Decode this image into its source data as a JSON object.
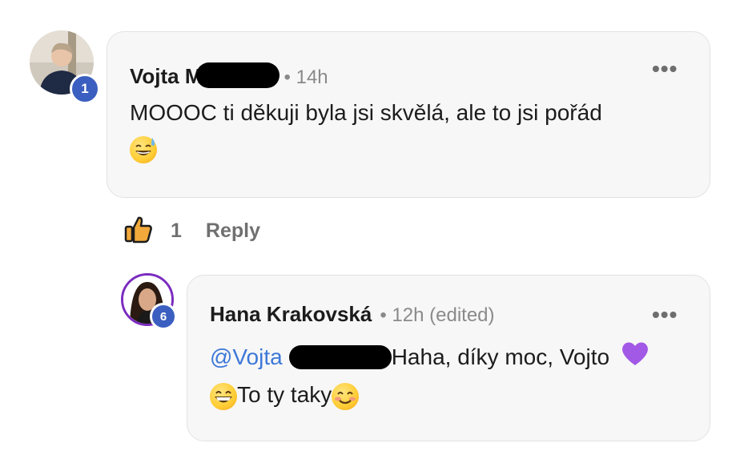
{
  "comment": {
    "author": "Vojta M",
    "time": "• 14h",
    "badge": "1",
    "text_line1": "MOOOC ti děkuji byla jsi skvělá, ale to jsi pořád",
    "emoji": "sweat-smile-emoji",
    "like_count": "1",
    "reply_label": "Reply"
  },
  "reply": {
    "author": "Hana Krakovská",
    "time": "• 12h (edited)",
    "badge": "6",
    "mention": "@Vojta",
    "text_after_mention": "Haha, díky moc, Vojto",
    "heart_emoji": "purple-heart-emoji",
    "text_line2": "To ty taky",
    "emoji_grin": "grinning-emoji",
    "emoji_smile": "smiling-emoji"
  },
  "icons": {
    "more": "more-horizontal-icon",
    "like": "thumbs-up-icon"
  },
  "colors": {
    "badge": "#3b5fc0",
    "mention": "#3d78d8",
    "card_bg": "#f7f7f7",
    "like_icon": "#f2a93b"
  }
}
